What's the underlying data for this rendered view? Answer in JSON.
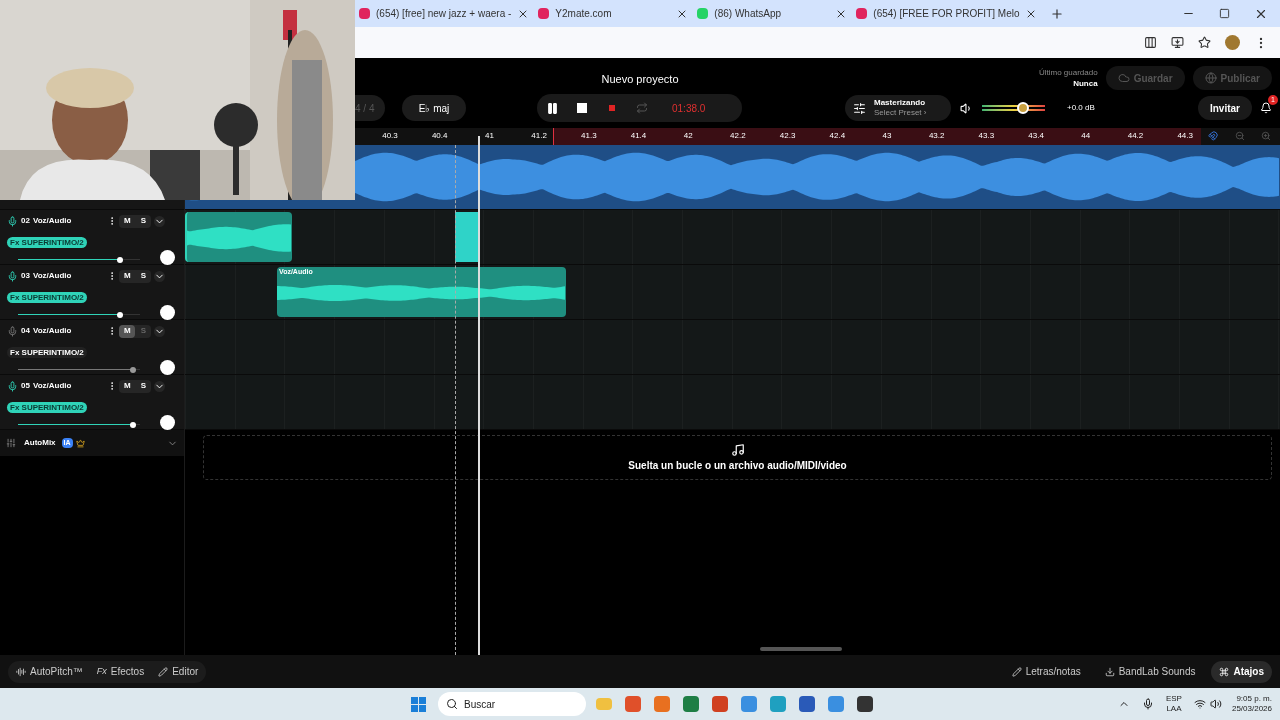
{
  "browser": {
    "tabs": [
      {
        "title": "(654) [free] new jazz + waera -",
        "selected": false,
        "color": "#e0245e"
      },
      {
        "title": "Y2mate.com",
        "selected": false,
        "color": "#e0245e"
      },
      {
        "title": "(86) WhatsApp",
        "selected": false,
        "color": "#25d366"
      },
      {
        "title": "(654) [FREE FOR PROFIT] Melo",
        "selected": false,
        "color": "#e0245e"
      }
    ]
  },
  "header": {
    "title": "Nuevo proyecto",
    "time_signature": "4 / 4",
    "key": "E♭ maj",
    "time": "01:38.0",
    "playing": true,
    "recording": true,
    "loop": false,
    "mastering": {
      "title": "Masterizando",
      "preset": "Select Preset ›"
    },
    "master_volume": {
      "level": 0.65,
      "reading": "+0.0 dB"
    },
    "last_saved": {
      "label": "Último guardado",
      "value": "Nunca"
    },
    "save": {
      "label": "Guardar",
      "disabled": true
    },
    "publish": {
      "label": "Publicar",
      "disabled": true
    },
    "invite": "Invitar",
    "notifications": "1"
  },
  "ruler": [
    "40.3",
    "40.4",
    "41",
    "41.2",
    "41.3",
    "41.4",
    "42",
    "42.2",
    "42.3",
    "42.4",
    "43",
    "43.2",
    "43.3",
    "43.4",
    "44",
    "44.2",
    "44.3"
  ],
  "tracks": [
    {
      "number": "02",
      "name": "Voz/Audio",
      "fx": "Fx SUPERINTIMO/2",
      "muted": false,
      "level": 0.84,
      "mute": "M",
      "solo": "S"
    },
    {
      "number": "03",
      "name": "Voz/Audio",
      "fx": "Fx SUPERINTIMO/2",
      "muted": false,
      "level": 0.84,
      "mute": "M",
      "solo": "S",
      "clip_label": "Voz/Audio"
    },
    {
      "number": "04",
      "name": "Voz/Audio",
      "fx": "Fx SUPERINTIMO/2",
      "muted": true,
      "level": 0.94,
      "mute": "M",
      "solo": "S"
    },
    {
      "number": "05",
      "name": "Voz/Audio",
      "fx": "Fx SUPERINTIMO/2",
      "muted": false,
      "level": 0.94,
      "mute": "M",
      "solo": "S"
    }
  ],
  "automix": {
    "label": "AutoMix",
    "badge": "IA"
  },
  "drop_zone": "Suelta un bucle o un archivo audio/MIDI/video",
  "bottom_bar": {
    "left": [
      {
        "label": "AutoPitch™",
        "selected": false
      },
      {
        "label": "Efectos",
        "icon": "Fx",
        "selected": false
      },
      {
        "label": "Editor",
        "selected": false
      }
    ],
    "right": [
      {
        "label": "Letras/notas",
        "selected": false
      },
      {
        "label": "BandLab Sounds",
        "selected": false
      },
      {
        "label": "Atajos",
        "selected": true
      }
    ]
  },
  "taskbar": {
    "search": "Buscar",
    "language": "ESP",
    "layout": "LAA",
    "time": "9:05 p. m.",
    "date": "25/03/2026"
  }
}
